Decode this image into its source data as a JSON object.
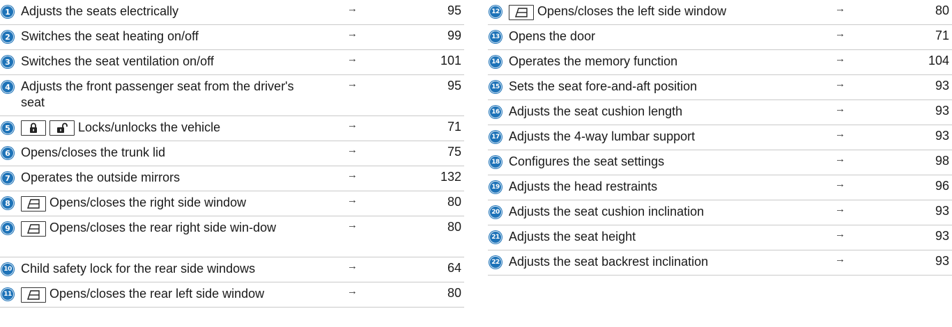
{
  "arrow": "→",
  "left": [
    {
      "num": "1",
      "text": "Adjusts the seats electrically",
      "page": "95"
    },
    {
      "num": "2",
      "text": "Switches the seat heating on/off",
      "page": "99"
    },
    {
      "num": "3",
      "text": "Switches the seat ventilation on/off",
      "page": "101"
    },
    {
      "num": "4",
      "text": "Adjusts the front passenger seat from the driver's seat",
      "page": "95"
    },
    {
      "num": "5",
      "text": "Locks/unlocks the vehicle",
      "page": "71",
      "icons": [
        "lock-icon",
        "unlock-icon"
      ]
    },
    {
      "num": "6",
      "text": "Opens/closes the trunk lid",
      "page": "75"
    },
    {
      "num": "7",
      "text": "Operates the outside mirrors",
      "page": "132"
    },
    {
      "num": "8",
      "text": "Opens/closes the right side window",
      "page": "80",
      "icons": [
        "window-icon"
      ]
    },
    {
      "num": "9",
      "text": "Opens/closes the rear right side win-dow",
      "page": "80",
      "icons": [
        "window-icon"
      ]
    },
    {
      "num": "10",
      "text": "Child safety lock for the rear side windows",
      "page": "64"
    },
    {
      "num": "11",
      "text": "Opens/closes the rear left side window",
      "page": "80",
      "icons": [
        "window-icon"
      ]
    }
  ],
  "right": [
    {
      "num": "12",
      "text": "Opens/closes the left side window",
      "page": "80",
      "icons": [
        "window-icon"
      ]
    },
    {
      "num": "13",
      "text": "Opens the door",
      "page": "71"
    },
    {
      "num": "14",
      "text": "Operates the memory function",
      "page": "104"
    },
    {
      "num": "15",
      "text": "Sets the seat fore-and-aft position",
      "page": "93"
    },
    {
      "num": "16",
      "text": "Adjusts the seat cushion length",
      "page": "93"
    },
    {
      "num": "17",
      "text": "Adjusts the 4-way lumbar support",
      "page": "93"
    },
    {
      "num": "18",
      "text": "Configures the seat settings",
      "page": "98"
    },
    {
      "num": "19",
      "text": "Adjusts the head restraints",
      "page": "96"
    },
    {
      "num": "20",
      "text": "Adjusts the seat cushion inclination",
      "page": "93"
    },
    {
      "num": "21",
      "text": "Adjusts the seat height",
      "page": "93"
    },
    {
      "num": "22",
      "text": "Adjusts the seat backrest inclination",
      "page": "93"
    }
  ]
}
